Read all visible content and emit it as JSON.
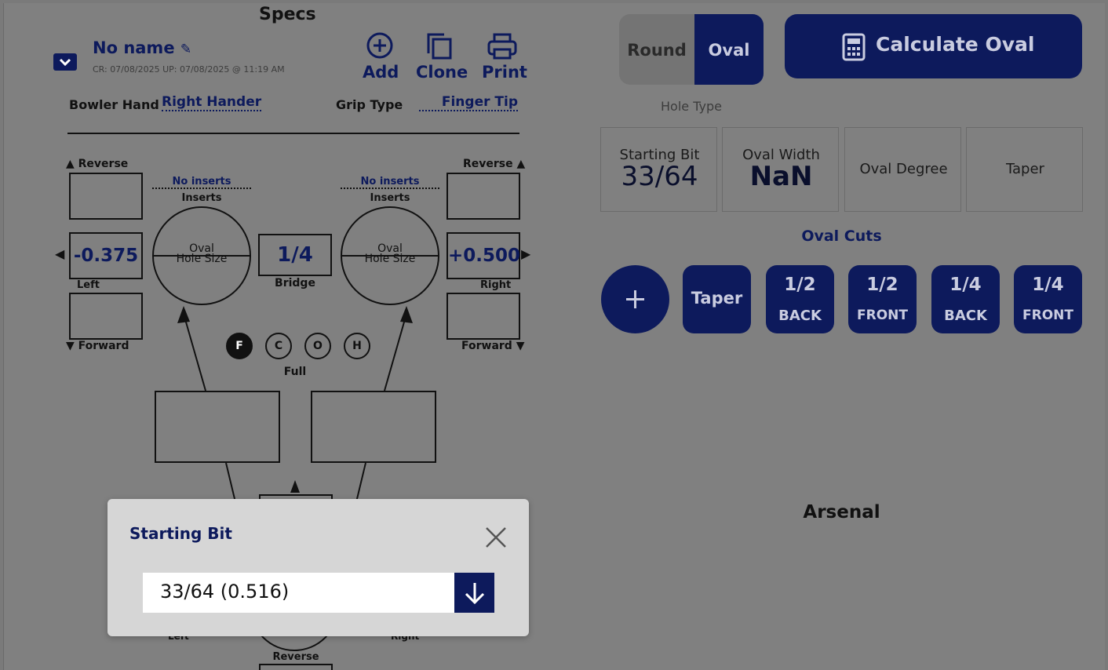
{
  "specs": {
    "title": "Specs",
    "name": "No name",
    "dates": "CR: 07/08/2025 UP: 07/08/2025 @ 11:19 AM",
    "actions": {
      "add": "Add",
      "clone": "Clone",
      "print": "Print"
    },
    "bowler_hand_label": "Bowler Hand",
    "bowler_hand_value": "Right Hander",
    "grip_type_label": "Grip Type",
    "grip_type_value": "Finger Tip"
  },
  "diagram": {
    "reverse_left": "Reverse",
    "reverse_right": "Reverse",
    "forward_left": "Forward",
    "forward_right": "Forward",
    "left_inserts_value": "No inserts",
    "left_inserts_label": "Inserts",
    "right_inserts_value": "No inserts",
    "right_inserts_label": "Inserts",
    "left_hole_label_1": "Oval",
    "left_hole_label_2": "Hole Size",
    "right_hole_label_1": "Oval",
    "right_hole_label_2": "Hole Size",
    "left_value": "-0.375",
    "left_label": "Left",
    "right_value": "+0.500",
    "right_label": "Right",
    "bridge_value": "1/4",
    "bridge_label": "Bridge",
    "grip_modes": [
      "F",
      "C",
      "O",
      "H"
    ],
    "grip_mode_selected": "Full",
    "bottom_reverse": "Reverse",
    "bottom_left": "Left",
    "bottom_right": "Right"
  },
  "hole": {
    "types": [
      "Round",
      "Oval"
    ],
    "selected_type": "Oval",
    "type_label": "Hole Type",
    "calculate_label": "Calculate Oval",
    "stats": [
      {
        "label": "Starting Bit",
        "value": "33/64"
      },
      {
        "label": "Oval Width",
        "value": "NaN"
      },
      {
        "label": "Oval Degree",
        "value": ""
      },
      {
        "label": "Taper",
        "value": ""
      }
    ],
    "cuts_title": "Oval Cuts",
    "cuts": [
      {
        "top": "Taper",
        "bottom": ""
      },
      {
        "top": "1/2",
        "bottom": "BACK"
      },
      {
        "top": "1/2",
        "bottom": "FRONT"
      },
      {
        "top": "1/4",
        "bottom": "BACK"
      },
      {
        "top": "1/4",
        "bottom": "FRONT"
      }
    ]
  },
  "arsenal": {
    "title": "Arsenal"
  },
  "modal": {
    "title": "Starting Bit",
    "value": "33/64 (0.516)"
  },
  "colors": {
    "navy": "#0d1a5c",
    "overlay": "#808080",
    "modal_bg": "#d6d6d6"
  }
}
